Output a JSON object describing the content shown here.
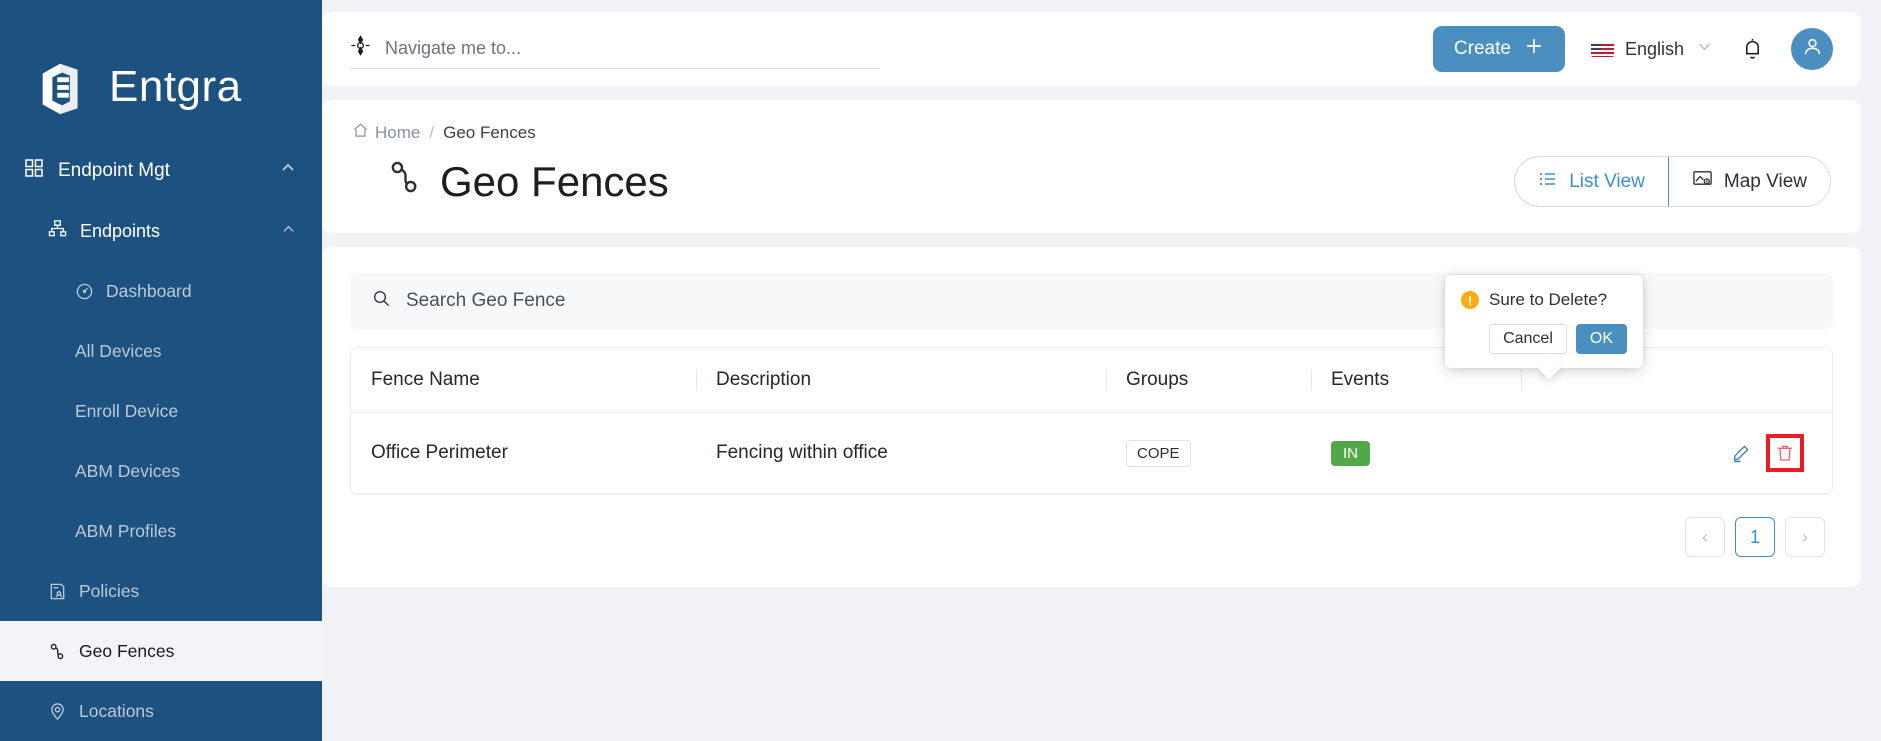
{
  "brand": {
    "name": "Entgra",
    "logo_icon": "entgra-logo-icon"
  },
  "sidebar": {
    "group": {
      "label": "Endpoint Mgt",
      "icon": "grid-icon",
      "chevron": "chevron-up-icon"
    },
    "section": {
      "label": "Endpoints",
      "icon": "sitemap-icon",
      "chevron": "chevron-up-icon"
    },
    "items": [
      {
        "label": "Dashboard",
        "icon": "gauge-icon",
        "active": false,
        "deep": true
      },
      {
        "label": "All Devices",
        "icon": "",
        "active": false,
        "deep": true
      },
      {
        "label": "Enroll Device",
        "icon": "",
        "active": false,
        "deep": true
      },
      {
        "label": "ABM Devices",
        "icon": "",
        "active": false,
        "deep": true
      },
      {
        "label": "ABM Profiles",
        "icon": "",
        "active": false,
        "deep": true
      },
      {
        "label": "Policies",
        "icon": "policy-doc-icon",
        "active": false,
        "deep": false
      },
      {
        "label": "Geo Fences",
        "icon": "geofence-icon",
        "active": true,
        "deep": false
      },
      {
        "label": "Locations",
        "icon": "location-pin-icon",
        "active": false,
        "deep": false
      }
    ]
  },
  "topbar": {
    "navigate": {
      "placeholder": "Navigate me to...",
      "value": "",
      "icon": "crosshair-icon"
    },
    "create_label": "Create",
    "create_icon": "plus-icon",
    "language": {
      "label": "English",
      "flag": "us-flag-icon",
      "chevron": "chevron-down-icon"
    },
    "notifications_icon": "bell-icon",
    "avatar_icon": "user-avatar-icon"
  },
  "breadcrumb": {
    "home": "Home",
    "home_icon": "home-icon",
    "separator": "/",
    "current": "Geo Fences"
  },
  "page": {
    "title": "Geo Fences",
    "title_icon": "geofence-icon"
  },
  "view_toggle": {
    "list": {
      "label": "List View",
      "icon": "list-icon",
      "active": true
    },
    "map": {
      "label": "Map View",
      "icon": "map-icon",
      "active": false
    }
  },
  "search": {
    "placeholder": "Search Geo Fence",
    "value": "",
    "icon": "search-icon"
  },
  "table": {
    "columns": [
      "Fence Name",
      "Description",
      "Groups",
      "Events",
      ""
    ],
    "rows": [
      {
        "fence_name": "Office Perimeter",
        "description": "Fencing within office",
        "groups": [
          "COPE"
        ],
        "events": [
          "IN"
        ],
        "edit_icon": "pencil-icon",
        "delete_icon": "trash-icon"
      }
    ]
  },
  "pagination": {
    "prev": "‹",
    "next": "›",
    "pages": [
      "1"
    ],
    "current": "1"
  },
  "delete_popover": {
    "message": "Sure to Delete?",
    "warning_icon": "warning-icon",
    "cancel_label": "Cancel",
    "ok_label": "OK"
  },
  "colors": {
    "sidebar_bg": "#1c5180",
    "accent_blue": "#4a8fc0",
    "link_blue": "#3e8ed0",
    "badge_green": "#52a849",
    "warning_orange": "#faad14",
    "danger_red": "#ec1c24",
    "page_bg": "#f0f2f5"
  }
}
